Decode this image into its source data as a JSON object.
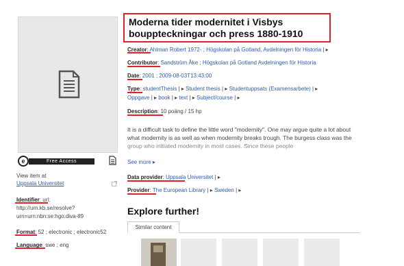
{
  "left": {
    "free_access_badge": "Free Access",
    "free_access_logo": "e",
    "view_item_at": "View item at",
    "view_item_link": "Uppsala Universitet",
    "identifier_label": "Identifier",
    "identifier_value_1": ": url:",
    "identifier_value_2": "http://urn.kb.se/resolve?",
    "identifier_value_3": "urn=urn:nbn:se:hgo:diva-89",
    "format_label": "Format",
    "format_value": ": 52 ; electronic ; electronic52",
    "language_label": "Language",
    "language_value": ": swe ; eng"
  },
  "record": {
    "title_line1": "Moderna tider modernitet i Visbys",
    "title_line2": "bouppteckningar och press 1880-1910",
    "creator_label": "Creator",
    "creator_value": "Ahlman Robert 1972- ; Högskolan på Gotland, Avdelningen för Historia",
    "contributor_label": "Contributor",
    "contributor_value": "Sandström Åke ; Högskolan på Gotland Avdelningen för Historia",
    "date_label": "Date",
    "date_value": "2001 ; 2009-08-03T13:43:00",
    "type_label": "Type",
    "type_items": [
      "studentThesis",
      "Student thesis",
      "Studentuppsats (Examensarbete)",
      "Oppgave",
      "book",
      "text",
      "Subject/course"
    ],
    "description_label": "Description",
    "description_value": "10 poäng / 15 hp",
    "description_body": "It is a difficult task to define the little word \"modernity\". One may argue quite a lot about what modernity is as well as when modernity breaks trough. The burgess class was the group who initiated modernity in most cases. Since these people",
    "see_more": "See more",
    "data_provider_label": "Data provider",
    "data_provider_value": "Uppsala Universitet",
    "provider_label": "Provider",
    "provider_items": [
      "The European Library",
      "Sweden"
    ]
  },
  "explore": {
    "heading": "Explore further!",
    "tab_label": "Similar content"
  },
  "colors": {
    "highlight": "#e0202a",
    "link": "#2a5db0"
  }
}
